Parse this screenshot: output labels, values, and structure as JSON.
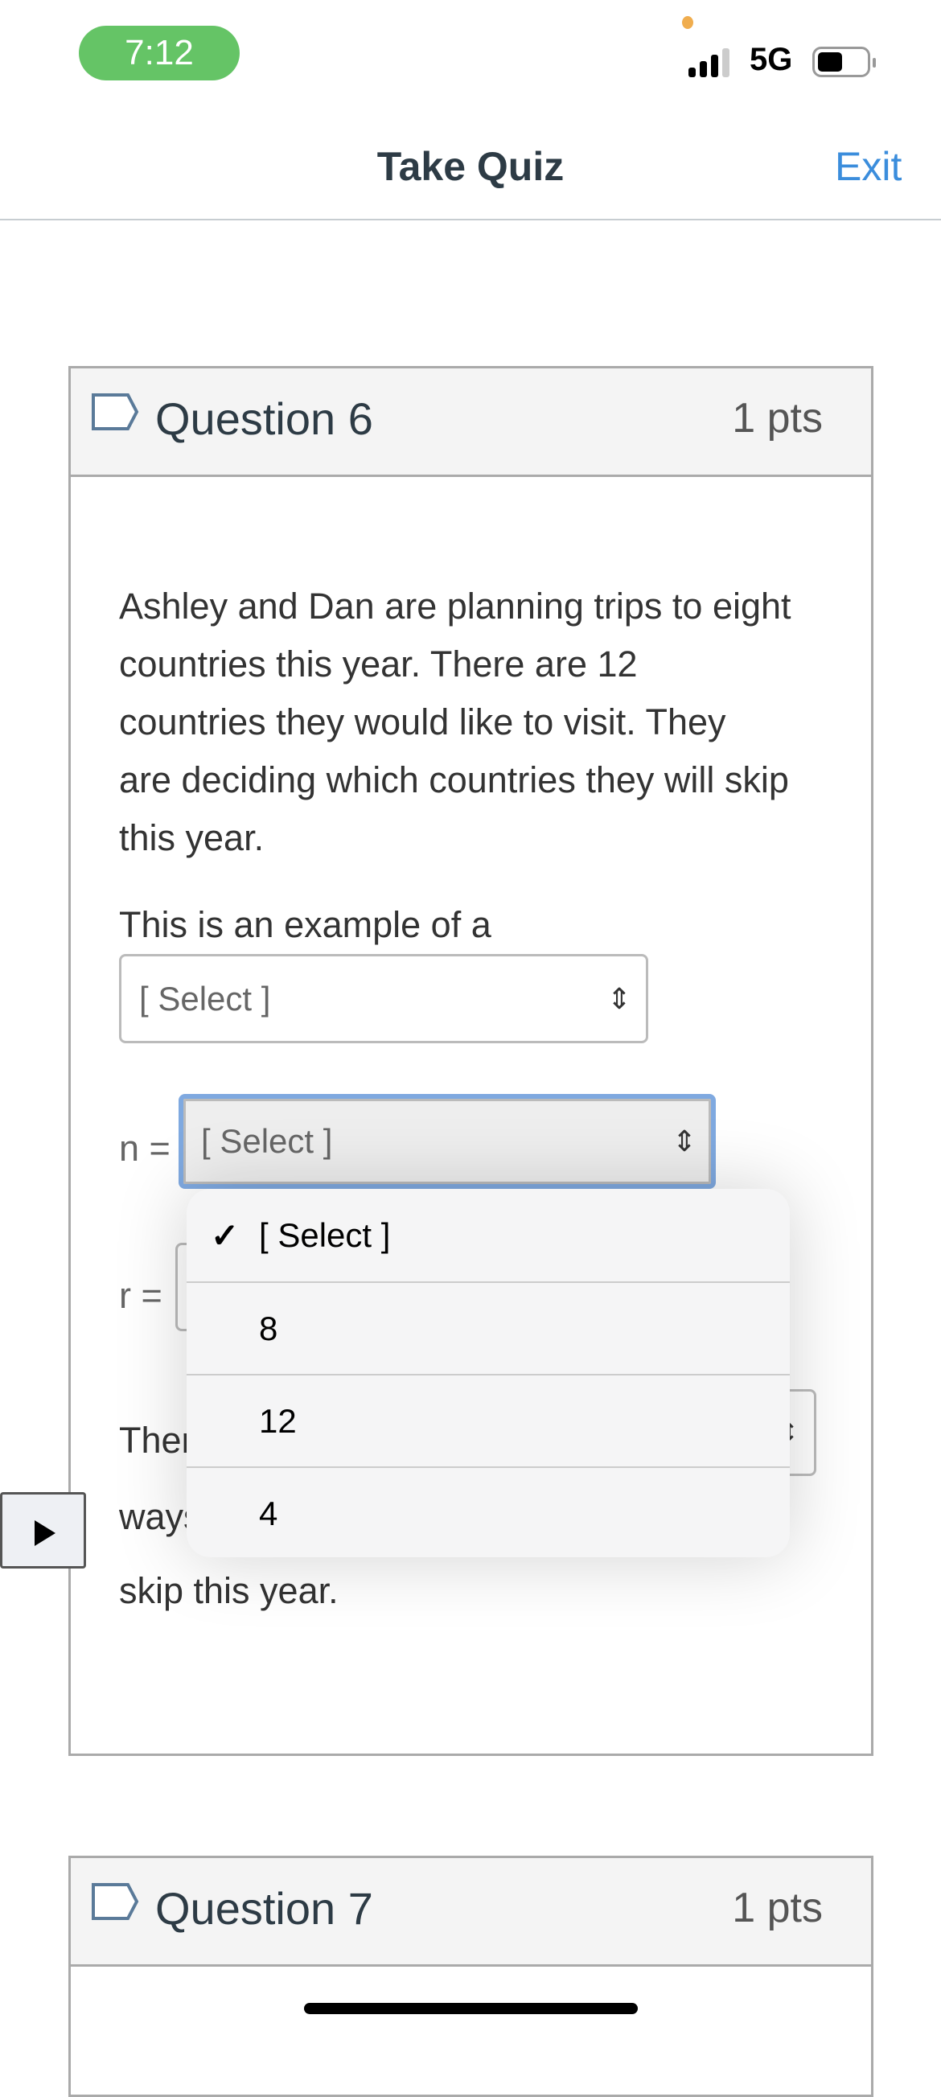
{
  "status_bar": {
    "time": "7:12",
    "network": "5G"
  },
  "header": {
    "title": "Take Quiz",
    "exit_label": "Exit"
  },
  "question6": {
    "title": "Question 6",
    "points": "1 pts",
    "text_lines": [
      "Ashley and Dan are planning trips to eight",
      "countries this year.  There are 12",
      "countries they would like to visit.  They",
      "are deciding which countries they will skip",
      "this year."
    ],
    "prompt": "This is an example of a",
    "select_type": {
      "value": "[ Select ]"
    },
    "n_label": "n =",
    "n_select": {
      "value": "[ Select ]"
    },
    "r_label": "r =",
    "there_text": "There",
    "ways_text": "ways",
    "skip_text": "skip this year."
  },
  "dropdown": {
    "options": [
      {
        "label": "[ Select ]",
        "checked": true
      },
      {
        "label": "8"
      },
      {
        "label": "12"
      },
      {
        "label": "4"
      }
    ]
  },
  "question7": {
    "title": "Question 7",
    "points": "1 pts"
  },
  "colors": {
    "accent": "#3b8ddc",
    "focus": "#7fa9e0",
    "time_pill": "#65c466"
  }
}
